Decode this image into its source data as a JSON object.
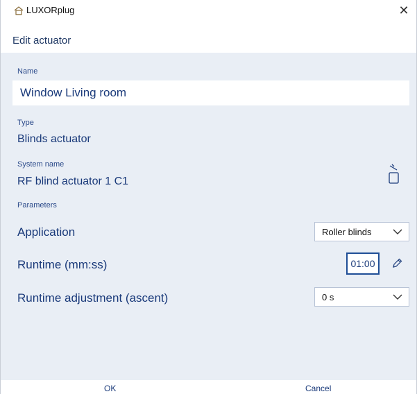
{
  "window": {
    "app_title": "LUXORplug",
    "app_icon": "house-icon",
    "close_symbol": "✕"
  },
  "header": {
    "title": "Edit actuator"
  },
  "name": {
    "label": "Name",
    "value": "Window Living room"
  },
  "type": {
    "label": "Type",
    "value": "Blinds actuator"
  },
  "system_name": {
    "label": "System name",
    "value": "RF blind actuator 1 C1",
    "delete_icon": "trash-icon"
  },
  "parameters": {
    "label": "Parameters",
    "application": {
      "label": "Application",
      "selected": "Roller blinds"
    },
    "runtime": {
      "label": "Runtime (mm:ss)",
      "value": "01:00",
      "edit_icon": "pencil-icon"
    },
    "runtime_adjustment": {
      "label": "Runtime adjustment (ascent)",
      "selected": "0 s"
    }
  },
  "footer": {
    "ok_label": "OK",
    "cancel_label": "Cancel"
  },
  "colors": {
    "accent": "#1f4e96",
    "background": "#e9eef5",
    "text": "#1a3a7a"
  }
}
